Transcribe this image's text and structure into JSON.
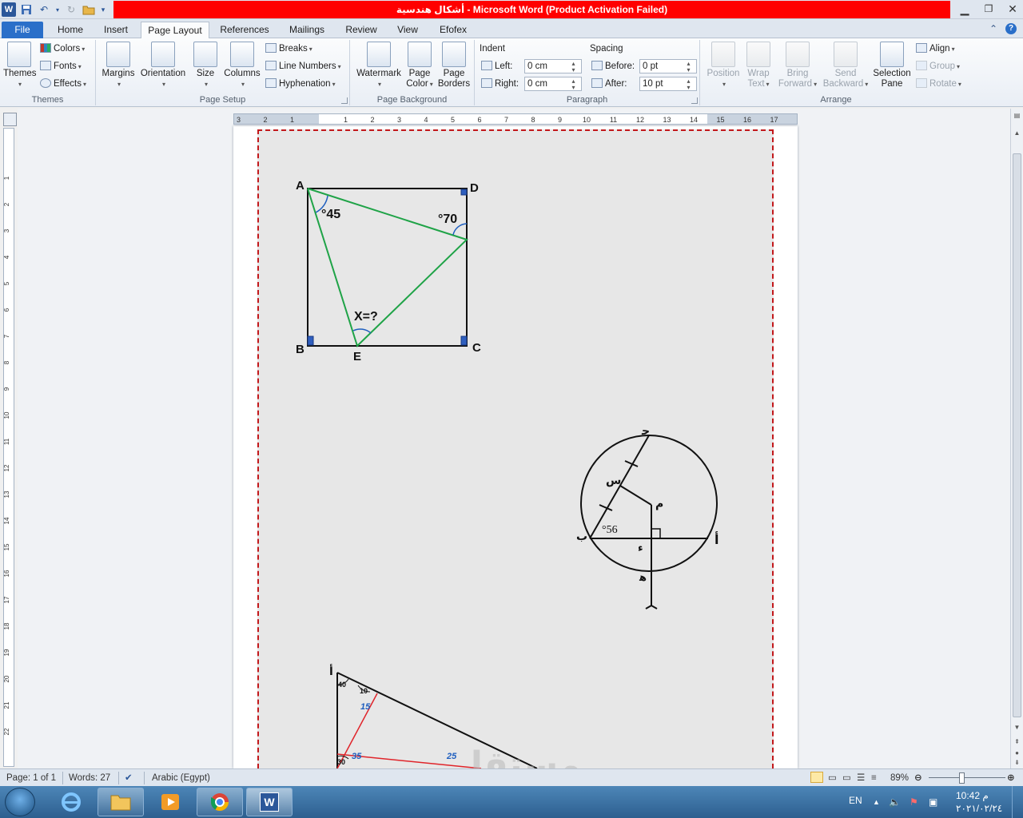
{
  "window": {
    "title": "أشكال هندسية  -  Microsoft Word (Product Activation Failed)"
  },
  "tabs": [
    "File",
    "Home",
    "Insert",
    "Page Layout",
    "References",
    "Mailings",
    "Review",
    "View",
    "Efofex"
  ],
  "active_tab": "Page Layout",
  "ribbon": {
    "themes": {
      "themes": "Themes",
      "colors": "Colors",
      "fonts": "Fonts",
      "effects": "Effects",
      "group": "Themes"
    },
    "page_setup": {
      "margins": "Margins",
      "orientation": "Orientation",
      "size": "Size",
      "columns": "Columns",
      "breaks": "Breaks",
      "line_numbers": "Line Numbers",
      "hyphenation": "Hyphenation",
      "group": "Page Setup"
    },
    "page_background": {
      "watermark": "Watermark",
      "page_color_1": "Page",
      "page_color_2": "Color",
      "page_borders_1": "Page",
      "page_borders_2": "Borders",
      "group": "Page Background"
    },
    "paragraph": {
      "indent": "Indent",
      "left_label": "Left:",
      "left_value": "0 cm",
      "right_label": "Right:",
      "right_value": "0 cm",
      "spacing": "Spacing",
      "before_label": "Before:",
      "before_value": "0 pt",
      "after_label": "After:",
      "after_value": "10 pt",
      "group": "Paragraph"
    },
    "arrange": {
      "position": "Position",
      "wrap_1": "Wrap",
      "wrap_2": "Text",
      "bring_1": "Bring",
      "bring_2": "Forward",
      "send_1": "Send",
      "send_2": "Backward",
      "selection_1": "Selection",
      "selection_2": "Pane",
      "align": "Align",
      "group_btn": "Group",
      "rotate": "Rotate",
      "group": "Arrange"
    }
  },
  "ruler_numbers": [
    "3",
    "2",
    "1",
    "1",
    "2",
    "3",
    "4",
    "5",
    "6",
    "7",
    "8",
    "9",
    "10",
    "11",
    "12",
    "13",
    "14",
    "15",
    "16",
    "17"
  ],
  "vruler_numbers": [
    "1",
    "2",
    "3",
    "4",
    "5",
    "6",
    "7",
    "8",
    "9",
    "10",
    "11",
    "12",
    "13",
    "14",
    "15",
    "16",
    "17",
    "18",
    "19",
    "20",
    "21",
    "22"
  ],
  "figures": {
    "square": {
      "A": "A",
      "B": "B",
      "C": "C",
      "D": "D",
      "E": "E",
      "angle_a": "°45",
      "angle_d": "°70",
      "question": "X=?"
    },
    "circle": {
      "j": "ﺣ",
      "s": "س",
      "m": "م",
      "b": "ب",
      "a": "أ",
      "d": "ء",
      "h": "ﻫ",
      "angle": "°56"
    },
    "triangle": {
      "top": "أ",
      "a40": "40",
      "a10": "10",
      "a15": "15",
      "a35": "35",
      "a25": "25",
      "a30": "30"
    },
    "watermark": "مستقل"
  },
  "status": {
    "page": "Page: 1 of 1",
    "words": "Words: 27",
    "language": "Arabic (Egypt)",
    "zoom": "89%"
  },
  "taskbar": {
    "lang": "EN",
    "time": "10:42 م",
    "date": "٢٠٢١/٠٢/٢٤"
  },
  "colors": {
    "title_bar_alert": "#ff0000",
    "green_lines": "#1fa347",
    "red_lines": "#e0242a",
    "blue_numbers": "#1f5fbf"
  }
}
